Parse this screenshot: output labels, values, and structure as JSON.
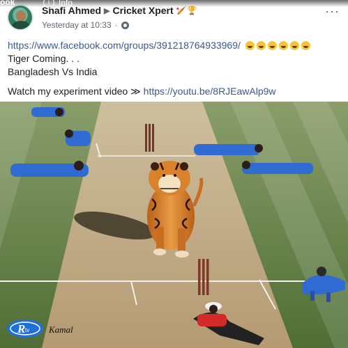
{
  "overlay": {
    "left_text": "ook",
    "info_label": "Info"
  },
  "post": {
    "author": "Shafi Ahmed",
    "group": "Cricket Xpert",
    "group_suffix_emoji": "🏏🏆",
    "timestamp": "Yesterday at 10:33",
    "more": "···",
    "link_line": "https://www.facebook.com/groups/391218764933969/",
    "emoji_count": 6,
    "line2": "Tiger Coming. . .",
    "line3": "Bangladesh Vs India",
    "video_prefix": "Watch my experiment video",
    "video_arrow": "≫",
    "video_link": "https://youtu.be/8RJEawAlp9w"
  },
  "image": {
    "logo_text": "R",
    "logo_sub": "tv",
    "signature": "Kamal",
    "colors": {
      "pitch": "#c9b491",
      "grass": "#5e7c3e",
      "jersey": "#2f6bd1",
      "tiger": "#d9822b"
    }
  }
}
